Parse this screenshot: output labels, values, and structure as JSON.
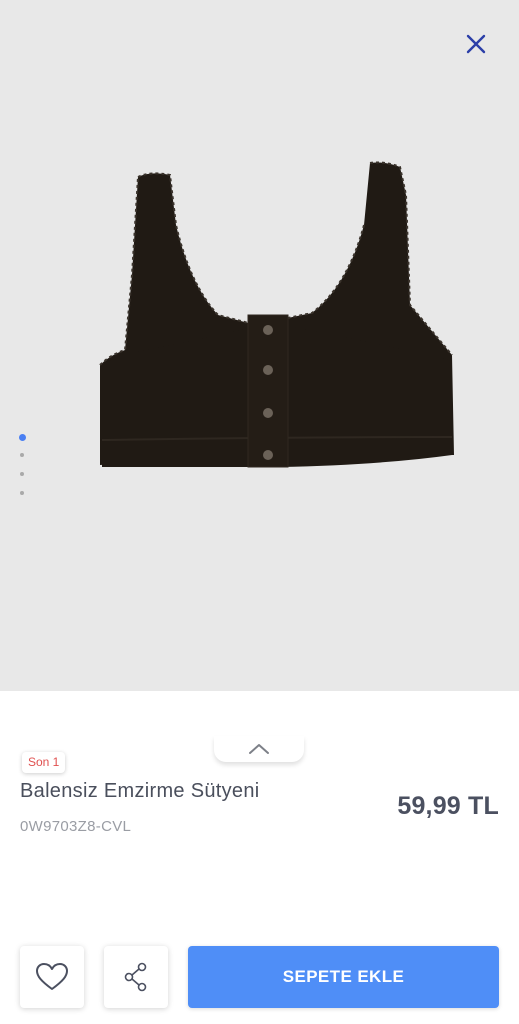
{
  "product": {
    "name": "Balensiz Emzirme Sütyeni",
    "code": "0W9703Z8-CVL",
    "price": "59,99 TL",
    "stock_badge": "Son 1",
    "image_alt": "black nursing bra"
  },
  "gallery": {
    "dot_count": 4,
    "active_dot": 0
  },
  "actions": {
    "cart_label": "SEPETE EKLE"
  },
  "icons": {
    "close": "close-icon",
    "favorite": "heart-icon",
    "share": "share-icon",
    "handle": "chevron-up-icon"
  },
  "colors": {
    "accent": "#4f8ef7",
    "close_icon": "#2c3fa8",
    "badge_text": "#e0504f",
    "gallery_bg": "#e8e8e8"
  }
}
